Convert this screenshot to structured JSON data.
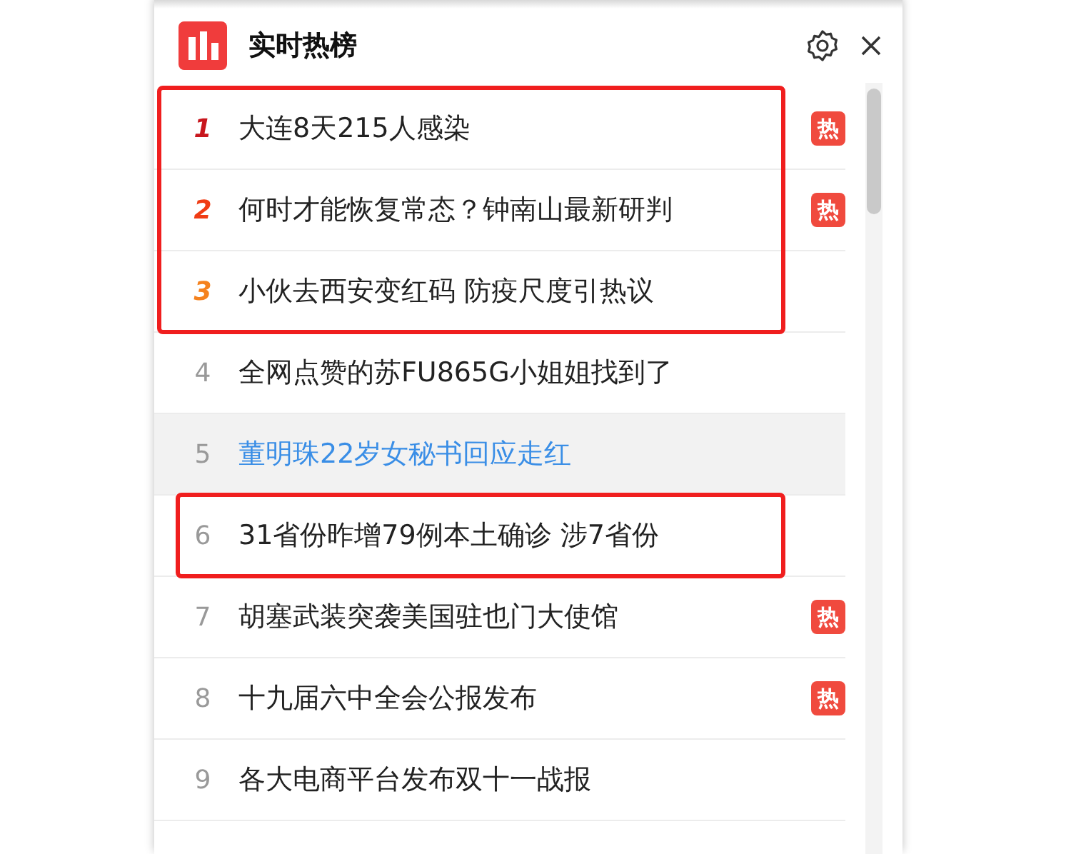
{
  "panel": {
    "title": "实时热榜"
  },
  "items": [
    {
      "rank": "1",
      "title": "大连8天215人感染",
      "color": "#c8161d",
      "badge": "热",
      "hovered": false,
      "boxed": true
    },
    {
      "rank": "2",
      "title": "何时才能恢复常态？钟南山最新研判",
      "color": "#f03c14",
      "badge": "热",
      "hovered": false,
      "boxed": true
    },
    {
      "rank": "3",
      "title": "小伙去西安变红码 防疫尺度引热议",
      "color": "#f5821e",
      "hovered": false,
      "boxed": true
    },
    {
      "rank": "4",
      "title": "全网点赞的苏FU865G小姐姐找到了",
      "color": "#999999",
      "hovered": false,
      "boxed": false
    },
    {
      "rank": "5",
      "title": "董明珠22岁女秘书回应走红",
      "color": "#999999",
      "hovered": true,
      "boxed": false
    },
    {
      "rank": "6",
      "title": "31省份昨增79例本土确诊 涉7省份",
      "color": "#999999",
      "hovered": false,
      "boxed": true
    },
    {
      "rank": "7",
      "title": "胡塞武装突袭美国驻也门大使馆",
      "color": "#999999",
      "badge": "热",
      "hovered": false,
      "boxed": false
    },
    {
      "rank": "8",
      "title": "十九届六中全会公报发布",
      "color": "#999999",
      "badge": "热",
      "hovered": false,
      "boxed": false
    },
    {
      "rank": "9",
      "title": "各大电商平台发布双十一战报",
      "color": "#999999",
      "hovered": false,
      "boxed": false
    }
  ]
}
